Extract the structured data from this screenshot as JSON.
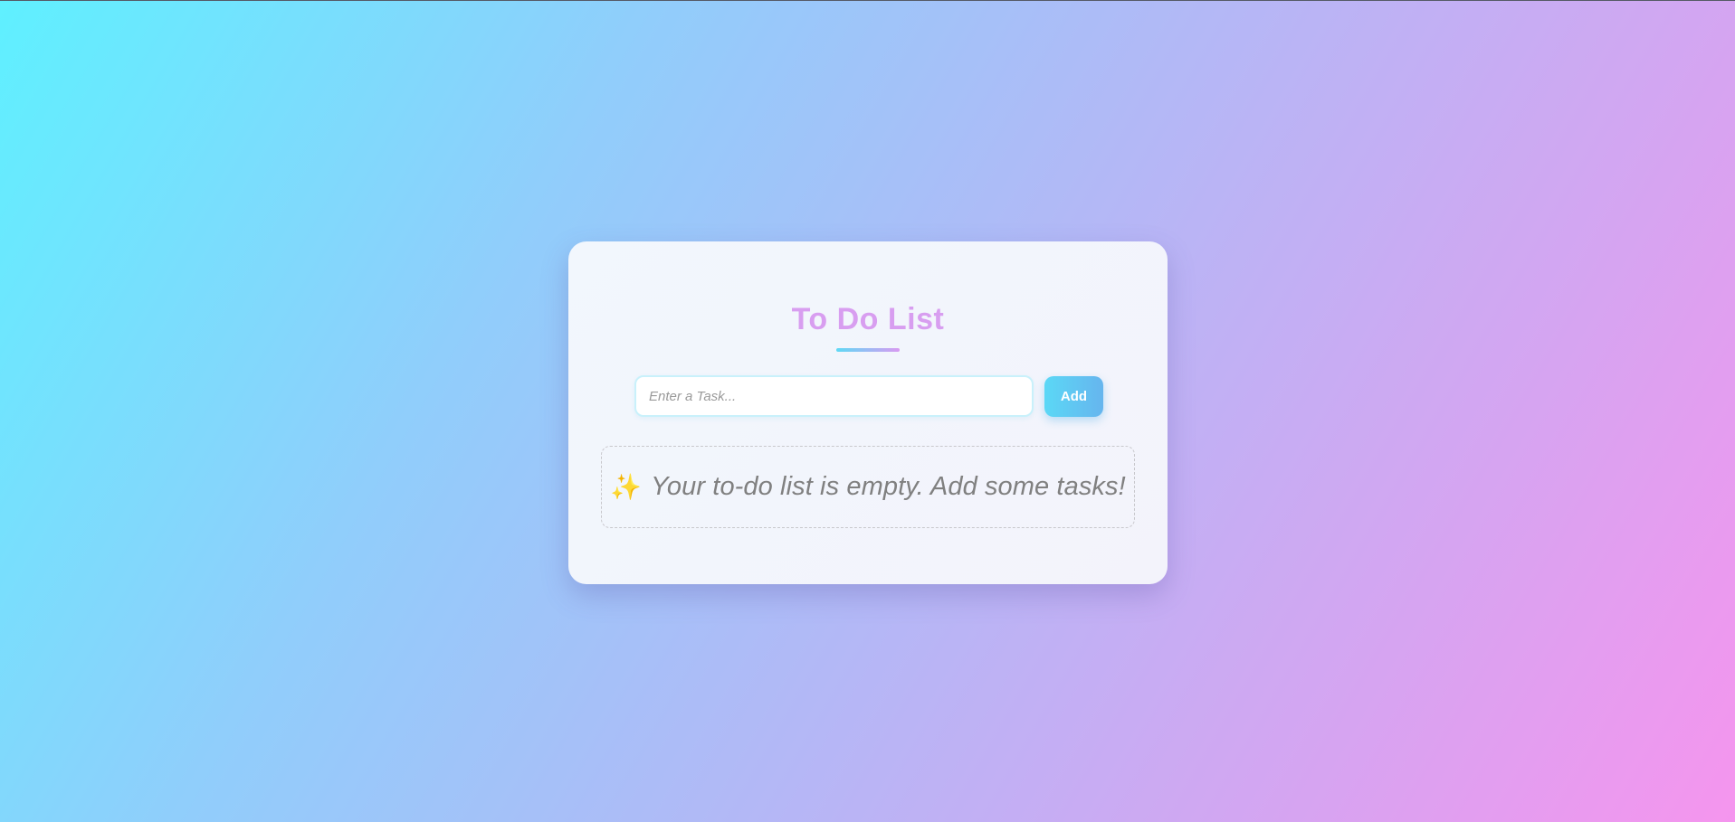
{
  "app": {
    "title": "To Do List"
  },
  "input": {
    "placeholder": "Enter a Task...",
    "value": ""
  },
  "actions": {
    "add_label": "Add"
  },
  "empty_state": {
    "icon": "sparkles-icon",
    "icon_glyph": "✨",
    "message": "Your to-do list is empty. Add some tasks!"
  },
  "colors": {
    "title": "#d89ef0",
    "accent_start": "#5bd8f6",
    "accent_end": "#d99af2"
  }
}
